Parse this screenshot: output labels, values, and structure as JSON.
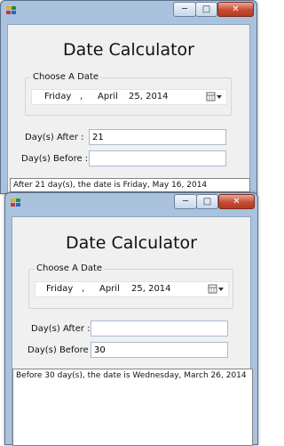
{
  "windows": [
    {
      "heading": "Date Calculator",
      "date_group_label": "Choose A Date",
      "date": {
        "weekday": "Friday",
        "separator": ",",
        "month": "April",
        "day_year": "25, 2014"
      },
      "days_after_label": "Day(s) After :",
      "days_after_value": "21",
      "days_before_label": "Day(s) Before :",
      "days_before_value": "",
      "result": "After 21 day(s), the date is Friday, May 16, 2014"
    },
    {
      "heading": "Date Calculator",
      "date_group_label": "Choose A Date",
      "date": {
        "weekday": "Friday",
        "separator": ",",
        "month": "April",
        "day_year": "25, 2014"
      },
      "days_after_label": "Day(s) After :",
      "days_after_value": "",
      "days_before_label": "Day(s) Before :",
      "days_before_value": "30",
      "result": "Before 30 day(s), the date is Wednesday, March 26, 2014"
    }
  ],
  "icons": {
    "app": "app-window-icon",
    "minimize": "minimize-icon",
    "maximize": "maximize-icon",
    "close": "close-icon",
    "calendar_dropdown": "calendar-dropdown-icon"
  },
  "colors": {
    "window_frame": "#a9c3df",
    "client": "#f0f0f0",
    "close_button": "#c74a32"
  }
}
